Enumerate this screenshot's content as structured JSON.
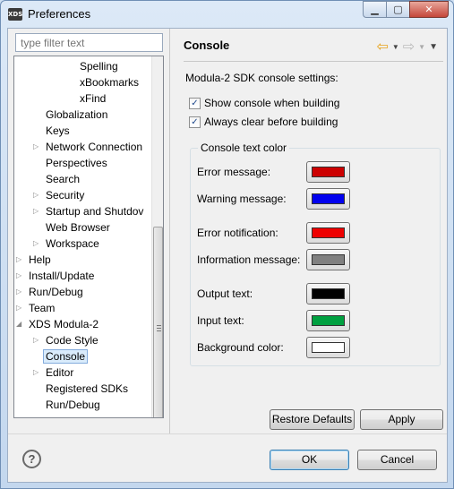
{
  "window": {
    "title": "Preferences",
    "icon_text": "XDS"
  },
  "filter": {
    "placeholder": "type filter text"
  },
  "tree": [
    {
      "label": "Spelling",
      "indent": 3,
      "arrow": false
    },
    {
      "label": "xBookmarks",
      "indent": 3,
      "arrow": false
    },
    {
      "label": "xFind",
      "indent": 3,
      "arrow": false
    },
    {
      "label": "Globalization",
      "indent": 2,
      "arrow": false
    },
    {
      "label": "Keys",
      "indent": 2,
      "arrow": false
    },
    {
      "label": "Network Connection",
      "indent": 2,
      "arrow": true
    },
    {
      "label": "Perspectives",
      "indent": 2,
      "arrow": false
    },
    {
      "label": "Search",
      "indent": 2,
      "arrow": false
    },
    {
      "label": "Security",
      "indent": 2,
      "arrow": true
    },
    {
      "label": "Startup and Shutdov",
      "indent": 2,
      "arrow": true
    },
    {
      "label": "Web Browser",
      "indent": 2,
      "arrow": false
    },
    {
      "label": "Workspace",
      "indent": 2,
      "arrow": true
    },
    {
      "label": "Help",
      "indent": 1,
      "arrow": true
    },
    {
      "label": "Install/Update",
      "indent": 1,
      "arrow": true
    },
    {
      "label": "Run/Debug",
      "indent": 1,
      "arrow": true
    },
    {
      "label": "Team",
      "indent": 1,
      "arrow": true
    },
    {
      "label": "XDS Modula-2",
      "indent": 1,
      "arrow": "open"
    },
    {
      "label": "Code Style",
      "indent": 2,
      "arrow": true
    },
    {
      "label": "Console",
      "indent": 2,
      "arrow": false,
      "selected": true
    },
    {
      "label": "Editor",
      "indent": 2,
      "arrow": true
    },
    {
      "label": "Registered SDKs",
      "indent": 2,
      "arrow": false
    },
    {
      "label": "Run/Debug",
      "indent": 2,
      "arrow": false
    }
  ],
  "page": {
    "title": "Console",
    "description": "Modula-2 SDK console settings:",
    "checkboxes": [
      {
        "label": "Show console when building",
        "checked": true
      },
      {
        "label": "Always clear before building",
        "checked": true
      }
    ],
    "group_title": "Console text color",
    "colors": [
      {
        "label": "Error message:",
        "color": "#cc0000"
      },
      {
        "label": "Warning message:",
        "color": "#0000ee"
      },
      {
        "label": "Error notification:",
        "color": "#ee0000"
      },
      {
        "label": "Information message:",
        "color": "#808080"
      },
      {
        "label": "Output text:",
        "color": "#000000"
      },
      {
        "label": "Input text:",
        "color": "#00a040"
      },
      {
        "label": "Background color:",
        "color": "#ffffff"
      }
    ],
    "restore_label": "Restore Defaults",
    "apply_label": "Apply"
  },
  "footer": {
    "ok_label": "OK",
    "cancel_label": "Cancel",
    "help_symbol": "?"
  }
}
